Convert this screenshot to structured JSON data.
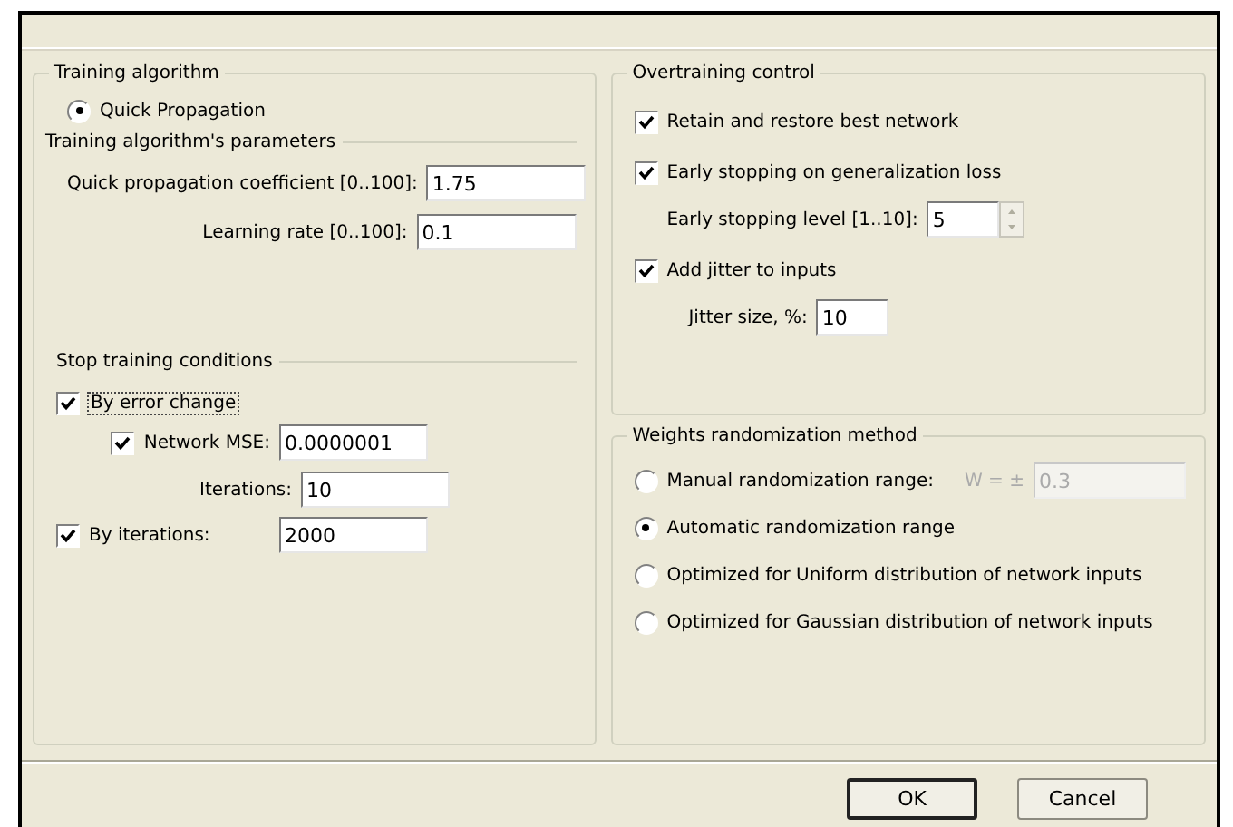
{
  "left_panel": {
    "title": "Training algorithm",
    "algorithms": [
      {
        "label": "Quick Propagation",
        "selected": true
      }
    ],
    "parameters": {
      "title": "Training algorithm's parameters",
      "fields": [
        {
          "label": "Quick propagation coefficient [0..100]:",
          "value": "1.75"
        },
        {
          "label": "Learning rate [0..100]:",
          "value": "0.1"
        }
      ]
    },
    "stop_conditions": {
      "title": "Stop training conditions",
      "items": [
        {
          "kind": "check",
          "label": "By error change",
          "checked": true,
          "focused": true,
          "children": [
            {
              "kind": "check_field",
              "label": "Network MSE:",
              "checked": true,
              "value": "0.0000001"
            },
            {
              "kind": "field",
              "label": "Iterations:",
              "value": "10"
            }
          ]
        },
        {
          "kind": "check_field",
          "label": "By iterations:",
          "checked": true,
          "value": "2000"
        }
      ]
    }
  },
  "overtraining_control": {
    "title": "Overtraining control",
    "items": [
      {
        "kind": "check",
        "label": "Retain and restore best network",
        "checked": true,
        "focused": false
      },
      {
        "kind": "check",
        "label": "Early stopping on generalization loss",
        "checked": true,
        "focused": false,
        "children": [
          {
            "kind": "spin",
            "label": "Early stopping level [1..10]:",
            "value": "5"
          }
        ]
      },
      {
        "kind": "check",
        "label": "Add jitter to inputs",
        "checked": true,
        "focused": false,
        "children": [
          {
            "kind": "field",
            "label": "Jitter size, %:",
            "value": "10"
          }
        ]
      }
    ]
  },
  "weights_randomization": {
    "title": "Weights randomization method",
    "options": [
      {
        "kind": "radio_field",
        "label": "Manual randomization range:",
        "selected": false,
        "prefix": "W = ±",
        "value": "0.3",
        "disabled": true
      },
      {
        "kind": "radio",
        "label": "Automatic randomization range",
        "selected": true
      },
      {
        "kind": "radio",
        "label": "Optimized for Uniform distribution of network inputs",
        "selected": false
      },
      {
        "kind": "radio",
        "label": "Optimized for Gaussian distribution of network inputs",
        "selected": false
      }
    ]
  },
  "buttons": [
    {
      "label": "OK",
      "default": true
    },
    {
      "label": "Cancel",
      "default": false
    }
  ]
}
